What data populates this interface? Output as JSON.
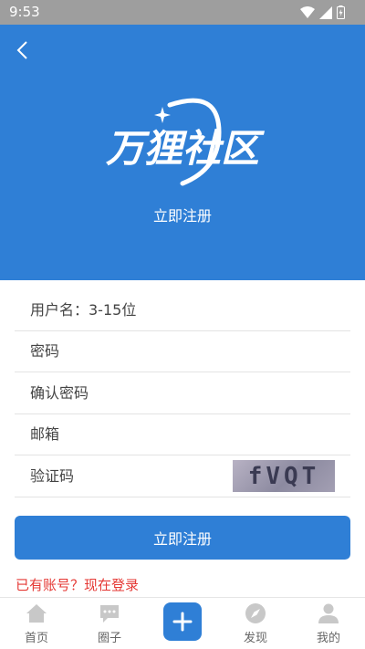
{
  "status": {
    "time": "9:53"
  },
  "header": {
    "brand_text": "万狸社区",
    "subtitle": "立即注册"
  },
  "form": {
    "username_placeholder": "用户名：3-15位",
    "password_placeholder": "密码",
    "confirm_placeholder": "确认密码",
    "email_placeholder": "邮箱",
    "captcha_placeholder": "验证码",
    "captcha_text": "fVQT"
  },
  "submit_label": "立即注册",
  "login_link": "已有账号？现在登录",
  "tabbar": {
    "home": "首页",
    "circle": "圈子",
    "discover": "发现",
    "mine": "我的"
  },
  "colors": {
    "primary": "#2f7fd6",
    "link": "#e53935",
    "statusbar": "#9e9e9e"
  }
}
